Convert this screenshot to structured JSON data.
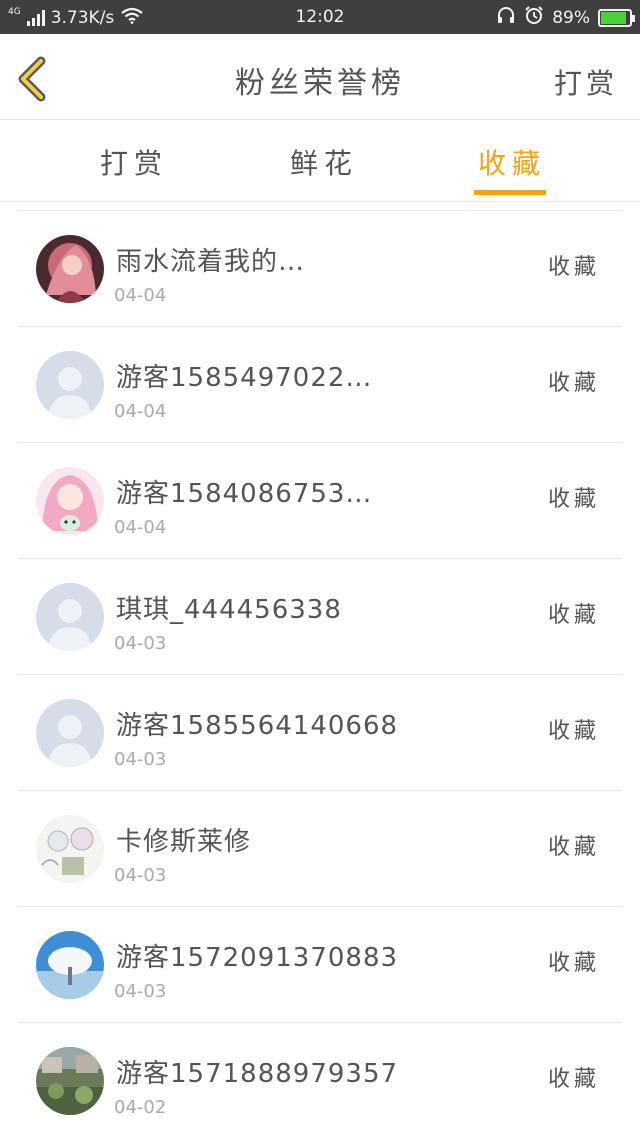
{
  "status_bar": {
    "network_gen": "4G",
    "speed": "3.73K/s",
    "time": "12:02",
    "battery": "89%",
    "battery_level": 0.89
  },
  "header": {
    "title": "粉丝荣誉榜",
    "action_label": "打赏"
  },
  "tabs": [
    {
      "label": "打赏",
      "active": false
    },
    {
      "label": "鲜花",
      "active": false
    },
    {
      "label": "收藏",
      "active": true
    }
  ],
  "colors": {
    "accent": "#f0a515",
    "text": "#555555",
    "muted": "#aaaaaa",
    "divider": "#e6e6e6"
  },
  "list": {
    "action_label": "收藏",
    "items": [
      {
        "name": "雨水流着我的…",
        "date": "04-04",
        "avatar": "anime-pink-avatar"
      },
      {
        "name": "游客1585497022…",
        "date": "04-04",
        "avatar": "default-avatar"
      },
      {
        "name": "游客1584086753…",
        "date": "04-04",
        "avatar": "anime-girl-avatar"
      },
      {
        "name": "琪琪_444456338",
        "date": "04-03",
        "avatar": "default-avatar"
      },
      {
        "name": "游客1585564140668",
        "date": "04-03",
        "avatar": "default-avatar"
      },
      {
        "name": "卡修斯莱修",
        "date": "04-03",
        "avatar": "sketch-avatar"
      },
      {
        "name": "游客1572091370883",
        "date": "04-03",
        "avatar": "snow-tree-avatar"
      },
      {
        "name": "游客1571888979357",
        "date": "04-02",
        "avatar": "garden-avatar"
      }
    ]
  }
}
